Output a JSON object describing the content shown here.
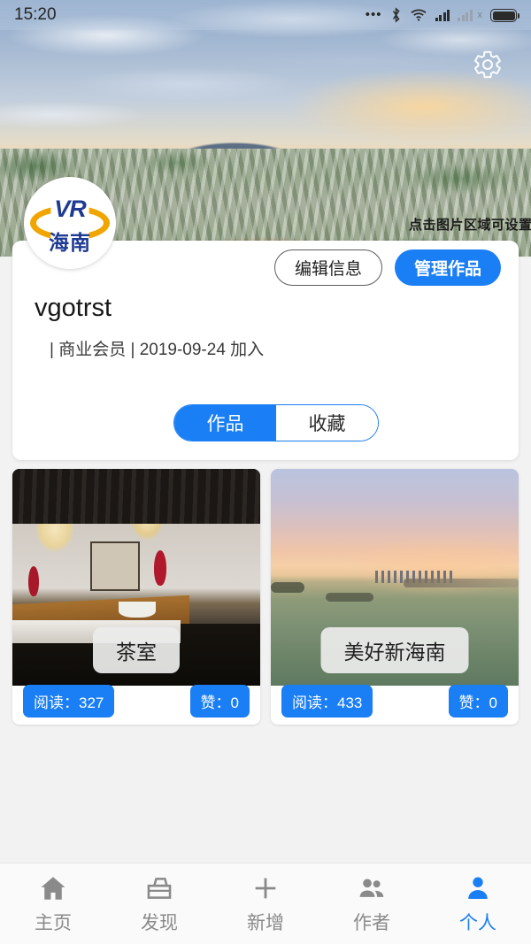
{
  "status_bar": {
    "time": "15:20",
    "icons": [
      "more-dots-icon",
      "bluetooth-icon",
      "wifi-icon",
      "signal-icon",
      "sim-no-service-icon",
      "battery-icon"
    ],
    "sim_label": "x"
  },
  "banner": {
    "hint_text": "点击图片区域可设置背景",
    "settings_icon": "gear-icon"
  },
  "avatar": {
    "logo_top": "VR",
    "logo_bottom": "海南",
    "logo_color": "#1f3a93",
    "ring_color": "#f0a500"
  },
  "profile": {
    "edit_button": "编辑信息",
    "manage_button": "管理作品",
    "username": "vgotrst",
    "meta": "| 商业会员 | 2019-09-24 加入",
    "tabs": [
      {
        "label": "作品",
        "active": true
      },
      {
        "label": "收藏",
        "active": false
      }
    ]
  },
  "works": [
    {
      "title": "茶室",
      "views_label": "阅读：327",
      "likes_label": "赞：0",
      "thumb": "tea-room-interior"
    },
    {
      "title": "美好新海南",
      "views_label": "阅读：433",
      "likes_label": "赞：0",
      "thumb": "coastal-sunset"
    }
  ],
  "bottom_nav": [
    {
      "label": "主页",
      "icon": "home-icon",
      "active": false
    },
    {
      "label": "发现",
      "icon": "box-discover-icon",
      "active": false
    },
    {
      "label": "新增",
      "icon": "plus-icon",
      "active": false
    },
    {
      "label": "作者",
      "icon": "people-icon",
      "active": false
    },
    {
      "label": "个人",
      "icon": "person-icon",
      "active": true
    }
  ],
  "colors": {
    "accent": "#1a7ef5",
    "nav_inactive": "#8a8a8a",
    "page_bg": "#f2f2f2"
  }
}
